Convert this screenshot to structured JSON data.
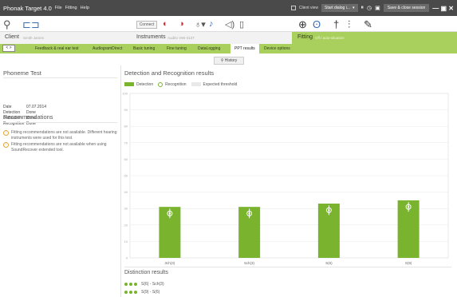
{
  "titlebar": {
    "app_title": "Phonak Target 4.0",
    "menus": [
      "File",
      "Fitting",
      "Help"
    ],
    "client_view_label": "Client view",
    "dialog_select": "Start dialog i...",
    "save_close": "Save & close session",
    "window_controls": "— ▣ ✕"
  },
  "toolbar": {
    "connect_label": "Connect"
  },
  "infobar": {
    "client_title": "Client",
    "client_name": "Smith James",
    "instruments_title": "Instruments",
    "instruments_detail": "Audéo V90-312T",
    "fitting_title": "Fitting",
    "fitting_detail": "Off / auto-situation"
  },
  "tabs": {
    "arrows": "< >",
    "items": [
      {
        "label": "Feedback & real ear test",
        "active": false
      },
      {
        "label": "AudiogramDirect",
        "active": false
      },
      {
        "label": "Basic tuning",
        "active": false
      },
      {
        "label": "Fine tuning",
        "active": false
      },
      {
        "label": "DataLogging",
        "active": false
      },
      {
        "label": "PPT results",
        "active": true
      },
      {
        "label": "Device options",
        "active": false
      }
    ]
  },
  "history_button": "History",
  "phoneme_test": {
    "title": "Phoneme Test",
    "rows": [
      {
        "key": "Date",
        "value": "07.07.2014"
      },
      {
        "key": "Detection",
        "value": "Done"
      },
      {
        "key": "Distinction",
        "value": "Done"
      },
      {
        "key": "Recognition",
        "value": "Done"
      }
    ]
  },
  "recommendations": {
    "title": "Recommendations",
    "items": [
      "Fitting recommendations are not available. Different hearing instruments were used for this test.",
      "Fitting recommendations are not available when using SoundRecover extended tool."
    ]
  },
  "results": {
    "title": "Detection and Recognition results",
    "legend": {
      "detection": "Detection",
      "recognition": "Recognition",
      "expected": "Expected threshold"
    }
  },
  "chart_data": {
    "type": "bar",
    "categories": [
      "3ch(3)",
      "5ch(3)",
      "S(6)",
      "S(9)"
    ],
    "series": [
      {
        "name": "Detection",
        "values": [
          31,
          31,
          33,
          35
        ]
      },
      {
        "name": "Recognition",
        "values": [
          27,
          27,
          29,
          31
        ]
      }
    ],
    "ylim": [
      0,
      100
    ],
    "yticks": [
      0,
      10,
      20,
      30,
      40,
      50,
      60,
      70,
      80,
      90,
      100
    ],
    "colors": {
      "detection": "#7ab32e",
      "recognition_marker": "#ffffff",
      "grid": "#e8e8e8"
    },
    "grid": true
  },
  "distinction": {
    "title": "Distinction results",
    "rows": [
      {
        "text": "S(6) - Sch(3)"
      },
      {
        "text": "S(9) - S(6)"
      }
    ]
  }
}
